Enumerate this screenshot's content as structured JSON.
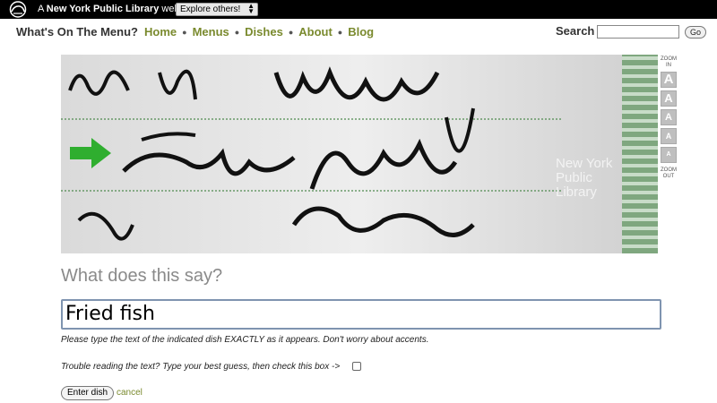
{
  "topbar": {
    "prefix": "A",
    "brand": "New York Public Library",
    "suffix": "website",
    "explore_label": "Explore others!"
  },
  "nav": {
    "site_title": "What's On The Menu?",
    "links": [
      "Home",
      "Menus",
      "Dishes",
      "About",
      "Blog"
    ],
    "search_label": "Search",
    "search_value": "",
    "go_label": "Go"
  },
  "image": {
    "watermark_lines": [
      "New York",
      "Public",
      "Library"
    ]
  },
  "zoom": {
    "in_label": "ZOOM IN",
    "out_label": "ZOOM OUT",
    "letter": "A"
  },
  "form": {
    "question": "What does this say?",
    "answer_value": "Fried fish",
    "instruction": "Please type the text of the indicated dish EXACTLY as it appears. Don't worry about accents.",
    "trouble_text": "Trouble reading the text? Type your best guess, then check this box ->",
    "enter_label": "Enter dish",
    "cancel_label": "cancel"
  },
  "colors": {
    "link_green": "#7a8a2e",
    "arrow_green": "#2fae2f"
  }
}
